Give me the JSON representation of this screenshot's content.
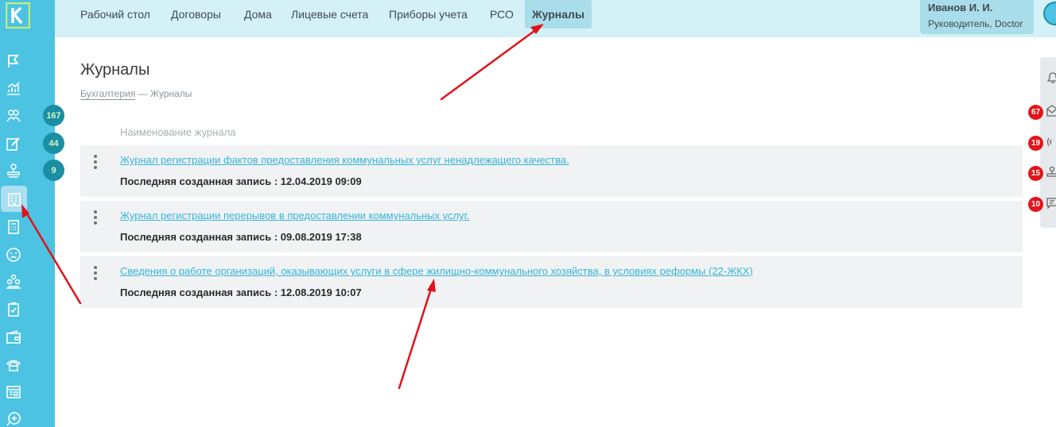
{
  "topnav": {
    "items": [
      {
        "label": "Рабочий стол"
      },
      {
        "label": "Договоры"
      },
      {
        "label": "Дома"
      },
      {
        "label": "Лицевые счета"
      },
      {
        "label": "Приборы учета"
      },
      {
        "label": "РСО"
      },
      {
        "label": "Журналы",
        "active": true
      }
    ]
  },
  "user": {
    "name": "Иванов И. И.",
    "role": "Руководитель, Doctor"
  },
  "sidebar": {
    "badges": [
      "167",
      "44",
      "9"
    ],
    "icons": [
      "flag-icon",
      "chart-icon",
      "people-icon",
      "edit-icon",
      "stamp-icon",
      "building-icon",
      "calculator-icon",
      "sad-face-icon",
      "group-icon",
      "clipboard-icon",
      "wallet-icon",
      "phone-icon",
      "dashboard-icon",
      "add-chat-icon"
    ]
  },
  "right_panel": {
    "badges": [
      "67",
      "19",
      "15",
      "10"
    ]
  },
  "page": {
    "title": "Журналы",
    "breadcrumb": {
      "parent": "Бухгалтерия",
      "separator": "—",
      "current": "Журналы"
    },
    "column_header": "Наименование журнала"
  },
  "journals": [
    {
      "title": "Журнал регистрации фактов предоставления коммунальных услуг ненадлежащего качества.",
      "meta_label": "Последняя созданная запись :",
      "meta_value": "12.04.2019 09:09"
    },
    {
      "title": "Журнал регистрации перерывов в предоставлении коммунальных услуг.",
      "meta_label": "Последняя созданная запись :",
      "meta_value": "09.08.2019 17:38"
    },
    {
      "title": "Сведения о работе организаций, оказывающих услуги в сфере жилищно-коммунального хозяйства, в условиях реформы (22-ЖКХ)",
      "meta_label": "Последняя созданная запись :",
      "meta_value": "12.08.2019 10:07"
    }
  ],
  "colors": {
    "sidebar": "#4cc3e3",
    "topbar": "#d4f1f8",
    "link": "#35b5d8",
    "badge_red": "#e4141b",
    "arrow": "#e0131a"
  }
}
